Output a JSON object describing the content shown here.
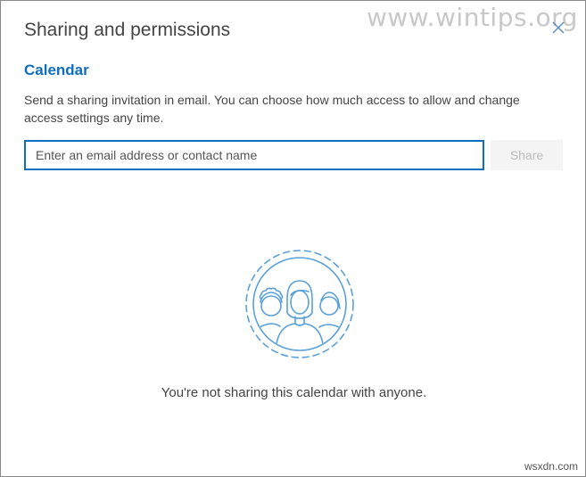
{
  "watermark": "www.wintips.org",
  "dialog": {
    "title": "Sharing and permissions",
    "calendar_name": "Calendar",
    "description": "Send a sharing invitation in email. You can choose how much access to allow and change access settings any time.",
    "email_placeholder": "Enter an email address or contact name",
    "email_value": "",
    "share_label": "Share",
    "empty_message": "You're not sharing this calendar with anyone.",
    "illustration_icon": "people-circle-icon",
    "close_icon": "close-icon"
  },
  "colors": {
    "accent": "#106ebe",
    "illustration": "#5aa0d8",
    "text": "#444444",
    "disabled_button_bg": "#f4f4f4",
    "disabled_button_text": "#bdbdbd"
  },
  "footer_watermark": "wsxdn.com"
}
